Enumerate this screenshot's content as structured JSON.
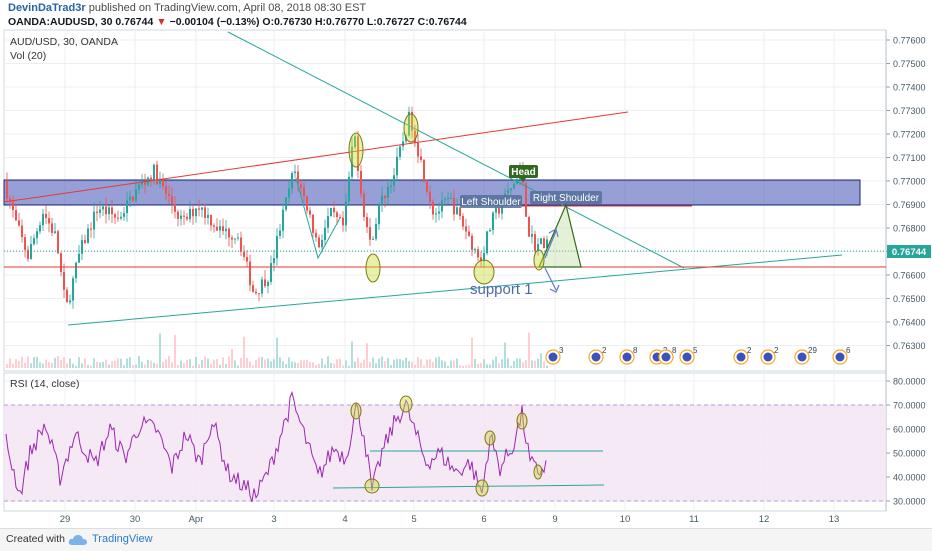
{
  "header": {
    "author": "DevinDaTrad3r",
    "published": "published on TradingView.com, April 08, 2018 08:30 EST",
    "symbol_line": "OANDA:AUDUSD, 30",
    "last": "0.76744",
    "change": "−0.00104 (−0.13%)",
    "ohlc": "O:0.76730 H:0.76770 L:0.76727 C:0.76744"
  },
  "price_pane": {
    "legend_symbol": "AUD/USD, 30, OANDA",
    "legend_volume": "Vol (20)",
    "y_ticks": [
      "0.77600",
      "0.77500",
      "0.77400",
      "0.77300",
      "0.77200",
      "0.77100",
      "0.77000",
      "0.76900",
      "0.76800",
      "0.76700",
      "0.76600",
      "0.76500",
      "0.76400",
      "0.76300"
    ],
    "current_price": "0.76744"
  },
  "rsi_pane": {
    "legend": "RSI (14, close)",
    "y_ticks": [
      "80.0000",
      "70.0000",
      "60.0000",
      "50.0000",
      "40.0000",
      "30.0000"
    ]
  },
  "x_ticks": [
    "29",
    "30",
    "Apr",
    "3",
    "4",
    "5",
    "6",
    "9",
    "10",
    "11",
    "12",
    "13"
  ],
  "annotations": {
    "head": "Head",
    "left_shoulder": "Left Shoulder",
    "right_shoulder": "Right Shoulder",
    "support": "support 1"
  },
  "events": [
    "3",
    "2",
    "8",
    "2",
    "8",
    "5",
    "2",
    "2",
    "29",
    "6"
  ],
  "footer": {
    "made": "Created with",
    "brand": "TradingView"
  },
  "colors": {
    "candle_up": "#26a69a",
    "candle_down": "#ef5350",
    "zone": "#3f51b5",
    "rsi_line": "#9c27b0",
    "rsi_band": "#f3e5f5",
    "resistance": "#e53935",
    "trend": "#26a69a"
  },
  "chart_data": [
    {
      "type": "candlestick",
      "title": "AUD/USD, 30, OANDA",
      "x": [
        "29",
        "30",
        "Apr",
        "3",
        "4",
        "5",
        "6",
        "9"
      ],
      "ylim": [
        0.7625,
        0.7765
      ],
      "key_points": {
        "start": 0.77,
        "low_29": 0.7645,
        "high_30": 0.7704,
        "low_apr2": 0.7652,
        "high_3": 0.7705,
        "high_4": 0.7722,
        "high_5": 0.7728,
        "low_6": 0.7666,
        "head": 0.7704,
        "last": 0.76744
      }
    },
    {
      "type": "line",
      "title": "RSI (14, close)",
      "x": [
        "29",
        "30",
        "Apr",
        "3",
        "4",
        "5",
        "6",
        "9"
      ],
      "ylim": [
        30,
        80
      ],
      "key_points": {
        "peak_4": 69,
        "peak_5": 70,
        "trough_4": 34,
        "trough_6": 33,
        "last": 45
      }
    }
  ]
}
